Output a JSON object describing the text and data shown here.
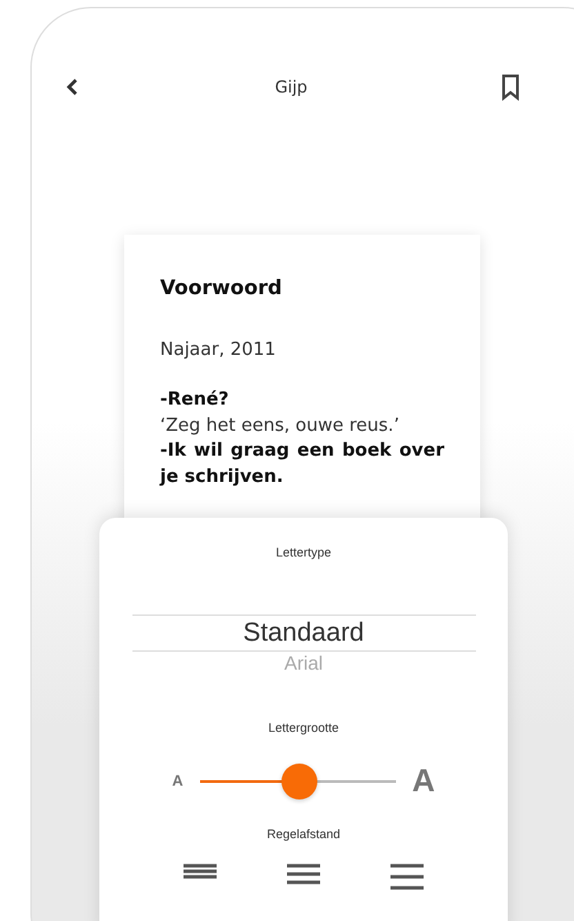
{
  "header": {
    "title": "Gijp"
  },
  "page": {
    "paragraphs": [
      {
        "text": "Voorwoord",
        "kind": "heading"
      },
      {
        "text": "Najaar, 2011",
        "kind": "plain"
      },
      {
        "text": "-René?",
        "kind": "bold"
      },
      {
        "text": "‘Zeg het eens, ouwe reus.’",
        "kind": "plain"
      },
      {
        "text": "-Ik wil graag een boek over je schrijven.",
        "kind": "bold"
      }
    ]
  },
  "settings": {
    "font_label": "Lettertype",
    "fonts": [
      {
        "label": "Standaard",
        "selected": true
      },
      {
        "label": "Arial",
        "selected": false
      }
    ],
    "size_label": "Lettergrootte",
    "size_small": "A",
    "size_large": "A",
    "size": {
      "level": 0.51
    },
    "spacing_label": "Regelafstand",
    "spacings": [
      {
        "kind": "narrow"
      },
      {
        "kind": "medium"
      },
      {
        "kind": "wide"
      }
    ]
  }
}
